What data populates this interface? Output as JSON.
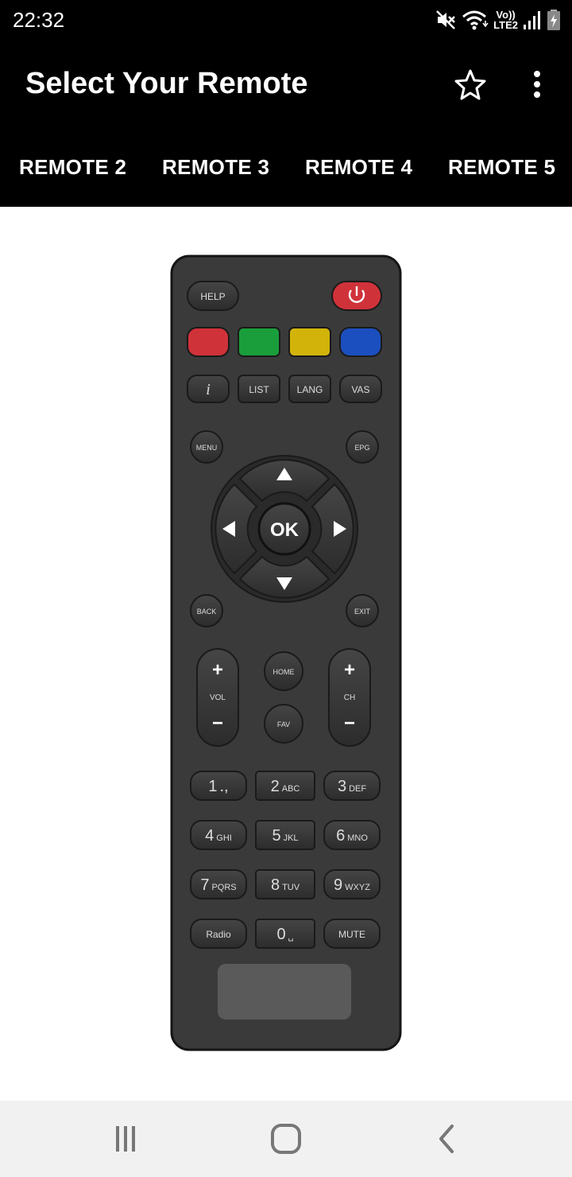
{
  "status_bar": {
    "time": "22:32",
    "icons": [
      "mute-icon",
      "wifi-icon",
      "volte-lte2-icon",
      "signal-icon",
      "battery-icon"
    ],
    "volte_top": "Vo))",
    "volte_bottom": "LTE2"
  },
  "app_bar": {
    "title": "Select Your Remote",
    "actions": [
      "star-icon",
      "more-vert-icon"
    ]
  },
  "tabs": [
    {
      "label": "REMOTE 2"
    },
    {
      "label": "REMOTE 3"
    },
    {
      "label": "REMOTE 4"
    },
    {
      "label": "REMOTE 5"
    }
  ],
  "remote": {
    "top_buttons": {
      "help": "HELP",
      "power_icon": "power-icon"
    },
    "color_buttons": [
      "#d0323a",
      "#1a9e3b",
      "#d2b30a",
      "#1b4fbf"
    ],
    "row_function": [
      "i",
      "LIST",
      "LANG",
      "VAS"
    ],
    "menu": "MENU",
    "epg": "EPG",
    "ok": "OK",
    "back": "BACK",
    "exit": "EXIT",
    "vol": "VOL",
    "ch": "CH",
    "home": "HOME",
    "fav": "FAV",
    "plus": "+",
    "minus": "−",
    "keypad": [
      {
        "digit": "1",
        "letters": ".,"
      },
      {
        "digit": "2",
        "letters": "ABC"
      },
      {
        "digit": "3",
        "letters": "DEF"
      },
      {
        "digit": "4",
        "letters": "GHI"
      },
      {
        "digit": "5",
        "letters": "JKL"
      },
      {
        "digit": "6",
        "letters": "MNO"
      },
      {
        "digit": "7",
        "letters": "PQRS"
      },
      {
        "digit": "8",
        "letters": "TUV"
      },
      {
        "digit": "9",
        "letters": "WXYZ"
      }
    ],
    "radio": "Radio",
    "zero": "0",
    "zero_letters": "␣",
    "mute": "MUTE",
    "colors": {
      "body": "#3c3c3c",
      "button": "#343434",
      "edge": "#1a1a1a",
      "text": "#d8d8d8",
      "ir_window": "#5a5a5a"
    }
  },
  "nav_bar": {
    "buttons": [
      "recent-apps-icon",
      "home-icon",
      "back-icon"
    ]
  }
}
